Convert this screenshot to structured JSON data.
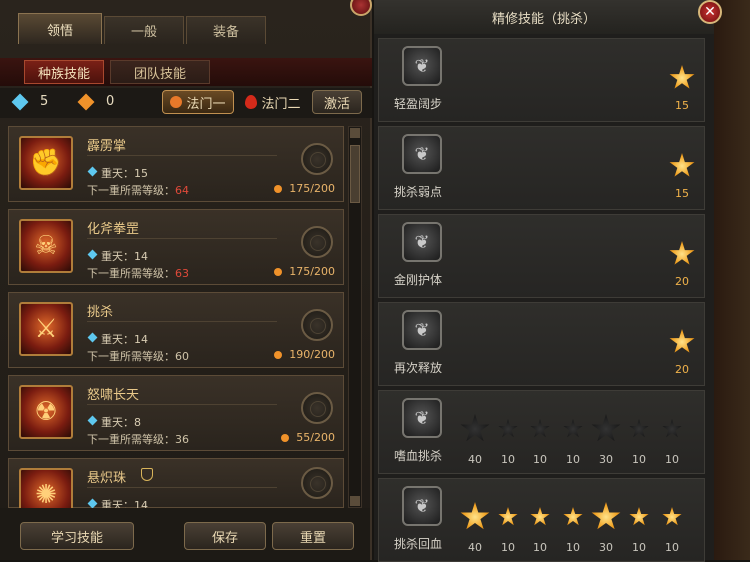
{
  "left_panel": {
    "tabs": [
      "领悟",
      "一般",
      "装备"
    ],
    "subtabs": [
      "种族技能",
      "团队技能"
    ],
    "points": {
      "blue": "5",
      "gold": "0"
    },
    "fa_buttons": [
      "法门一",
      "法门二"
    ],
    "activate_label": "激活",
    "skills": [
      {
        "name": "霹雳掌",
        "level_text": "重天：15",
        "need_label": "下一重所需等级：",
        "need_value": "64",
        "need_color": "#e04a3a",
        "cost": "175/200",
        "symbol": "✊"
      },
      {
        "name": "化斧拳罡",
        "level_text": "重天：14",
        "need_label": "下一重所需等级：",
        "need_value": "63",
        "need_color": "#e04a3a",
        "cost": "175/200",
        "symbol": "☠"
      },
      {
        "name": "挑杀",
        "level_text": "重天：14",
        "need_label": "下一重所需等级：",
        "need_value": "60",
        "need_color": "#cfc3a8",
        "cost": "190/200",
        "symbol": "⚔"
      },
      {
        "name": "怒啸长天",
        "level_text": "重天：8",
        "need_label": "下一重所需等级：",
        "need_value": "36",
        "need_color": "#cfc3a8",
        "cost": "55/200",
        "symbol": "☢"
      },
      {
        "name": "悬炽珠",
        "level_text": "重天：14",
        "need_label": "",
        "need_value": "",
        "need_color": "#cfc3a8",
        "cost": "",
        "symbol": "✺"
      }
    ],
    "learn_label": "学习技能",
    "save_label": "保存",
    "reset_label": "重置"
  },
  "right_panel": {
    "title": "精修技能（挑杀）",
    "rows": [
      {
        "name": "轻盈阔步",
        "stars": [
          {
            "value": "15",
            "lit": true
          }
        ]
      },
      {
        "name": "挑杀弱点",
        "stars": [
          {
            "value": "15",
            "lit": true
          }
        ]
      },
      {
        "name": "金刚护体",
        "stars": [
          {
            "value": "20",
            "lit": true
          }
        ]
      },
      {
        "name": "再次释放",
        "stars": [
          {
            "value": "20",
            "lit": true
          }
        ]
      },
      {
        "name": "嗜血挑杀",
        "stars": [
          {
            "value": "40",
            "lit": false,
            "big": true
          },
          {
            "value": "10",
            "lit": false
          },
          {
            "value": "10",
            "lit": false
          },
          {
            "value": "10",
            "lit": false
          },
          {
            "value": "30",
            "lit": false,
            "big": true
          },
          {
            "value": "10",
            "lit": false
          },
          {
            "value": "10",
            "lit": false
          }
        ]
      },
      {
        "name": "挑杀回血",
        "stars": [
          {
            "value": "40",
            "lit": true,
            "big": true
          },
          {
            "value": "10",
            "lit": true
          },
          {
            "value": "10",
            "lit": true
          },
          {
            "value": "10",
            "lit": true
          },
          {
            "value": "30",
            "lit": true,
            "big": true
          },
          {
            "value": "10",
            "lit": true
          },
          {
            "value": "10",
            "lit": true
          }
        ]
      }
    ]
  },
  "colors": {
    "accent_red": "#7a2016",
    "gold": "#f0a020",
    "need_red": "#e04a3a"
  },
  "icons": {
    "close": "close-icon",
    "blue_point": "blue-gem-icon",
    "gold_point": "gold-gem-icon"
  }
}
